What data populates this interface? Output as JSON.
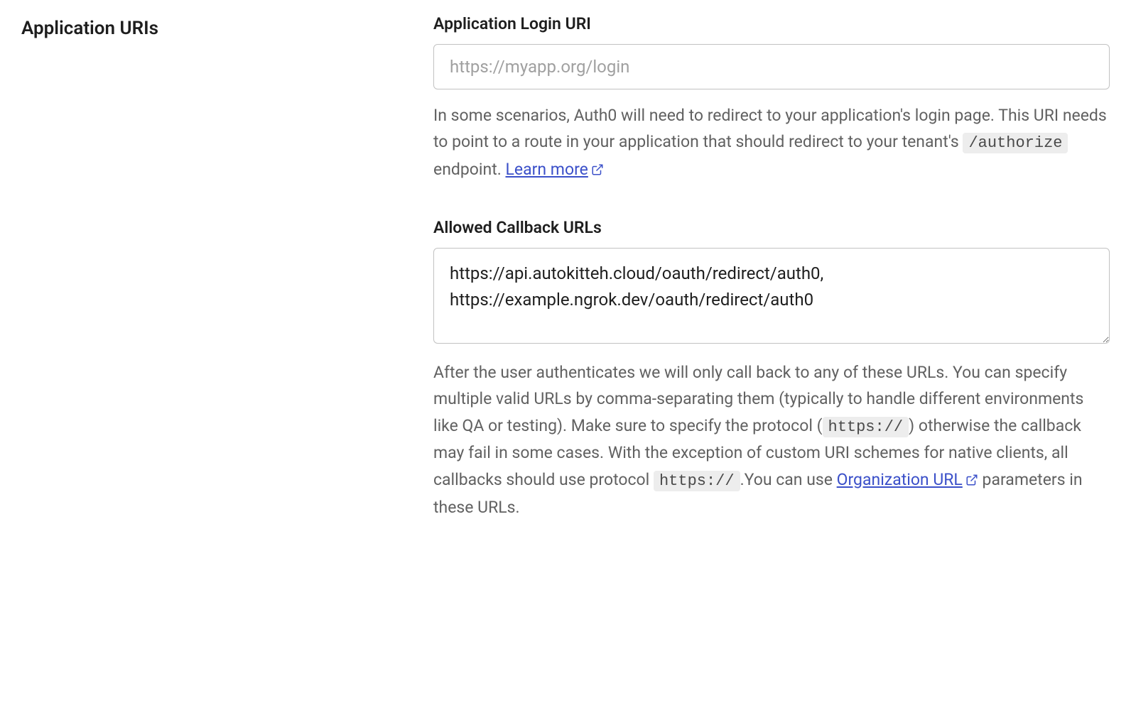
{
  "section": {
    "heading": "Application URIs"
  },
  "login_uri": {
    "label": "Application Login URI",
    "placeholder": "https://myapp.org/login",
    "value": "",
    "help_before_code": "In some scenarios, Auth0 will need to redirect to your application's login page. This URI needs to point to a route in your application that should redirect to your tenant's ",
    "help_code": "/authorize",
    "help_after_code": " endpoint. ",
    "learn_more": "Learn more"
  },
  "callback_urls": {
    "label": "Allowed Callback URLs",
    "value": "https://api.autokitteh.cloud/oauth/redirect/auth0, https://example.ngrok.dev/oauth/redirect/auth0",
    "help_part1": "After the user authenticates we will only call back to any of these URLs. You can specify multiple valid URLs by comma-separating them (typically to handle different environments like QA or testing). Make sure to specify the protocol (",
    "help_code1": "https://",
    "help_part2": ") otherwise the callback may fail in some cases. With the exception of custom URI schemes for native clients, all callbacks should use protocol ",
    "help_code2": "https://",
    "help_part3": ".You can use ",
    "org_url_link": "Organization URL",
    "help_part4": " parameters in these URLs."
  }
}
